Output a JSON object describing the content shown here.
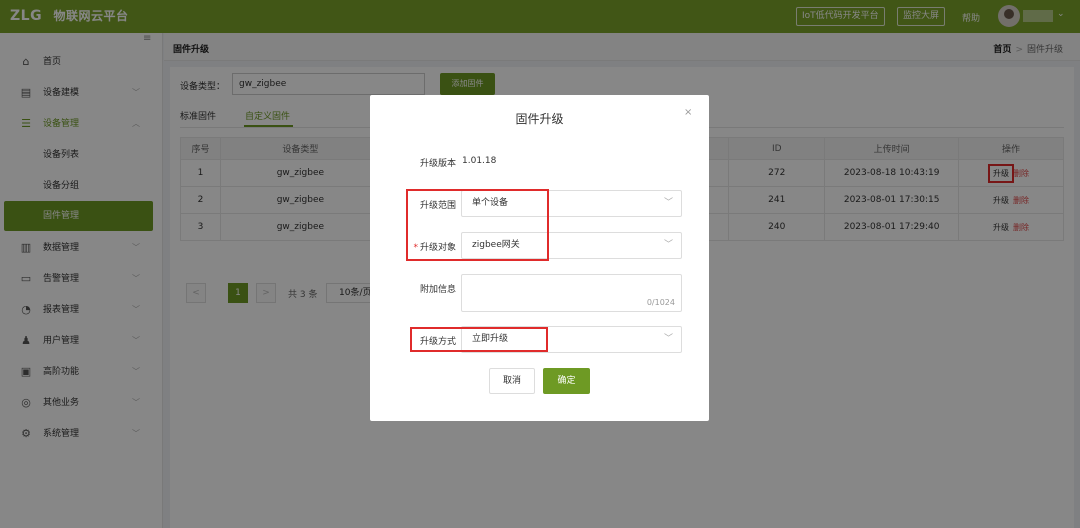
{
  "topbar": {
    "brand": "ZLG",
    "title": "物联网云平台",
    "lowcode_label": "IoT低代码开发平台",
    "bigscreen_label": "监控大屏",
    "help_label": "帮助"
  },
  "sidebar": {
    "items": [
      {
        "label": "首页",
        "icon": "home-icon"
      },
      {
        "label": "设备建模",
        "icon": "device-model-icon"
      },
      {
        "label": "设备管理",
        "icon": "device-manage-icon"
      },
      {
        "label": "设备列表"
      },
      {
        "label": "设备分组"
      },
      {
        "label": "固件管理"
      },
      {
        "label": "数据管理",
        "icon": "bar-chart-icon"
      },
      {
        "label": "告警管理",
        "icon": "alarm-icon"
      },
      {
        "label": "报表管理",
        "icon": "report-icon"
      },
      {
        "label": "用户管理",
        "icon": "user-icon"
      },
      {
        "label": "高阶功能",
        "icon": "advanced-icon"
      },
      {
        "label": "其他业务",
        "icon": "other-icon"
      },
      {
        "label": "系统管理",
        "icon": "settings-icon"
      }
    ]
  },
  "page": {
    "title": "固件升级",
    "breadcrumb_home": "首页",
    "breadcrumb_current": "固件升级"
  },
  "filter": {
    "type_label": "设备类型：",
    "type_value": "gw_zigbee",
    "add_button": "添加固件"
  },
  "tabs": [
    "标准固件",
    "自定义固件"
  ],
  "table": {
    "headers": [
      "序号",
      "设备类型",
      "ID",
      "上传时间",
      "操作"
    ],
    "rows": [
      {
        "no": "1",
        "type": "gw_zigbee",
        "id": "272",
        "time": "2023-08-18 10:43:19"
      },
      {
        "no": "2",
        "type": "gw_zigbee",
        "id": "241",
        "time": "2023-08-01 17:30:15"
      },
      {
        "no": "3",
        "type": "gw_zigbee",
        "id": "240",
        "time": "2023-08-01 17:29:40"
      }
    ],
    "action_upgrade": "升级",
    "action_delete": "删除"
  },
  "pager": {
    "current": "1",
    "total": "共 3 条",
    "page_size": "10条/页"
  },
  "modal": {
    "title": "固件升级",
    "version_label": "升级版本",
    "version_value": "1.01.18",
    "scope_label": "升级范围",
    "scope_value": "单个设备",
    "target_label": "升级对象",
    "target_value": "zigbee网关",
    "extra_label": "附加信息",
    "extra_counter": "0/1024",
    "method_label": "升级方式",
    "method_value": "立即升级",
    "cancel": "取消",
    "confirm": "确定"
  },
  "colors": {
    "brand_green": "#6e9a24",
    "highlight_red": "#e02b2b"
  }
}
